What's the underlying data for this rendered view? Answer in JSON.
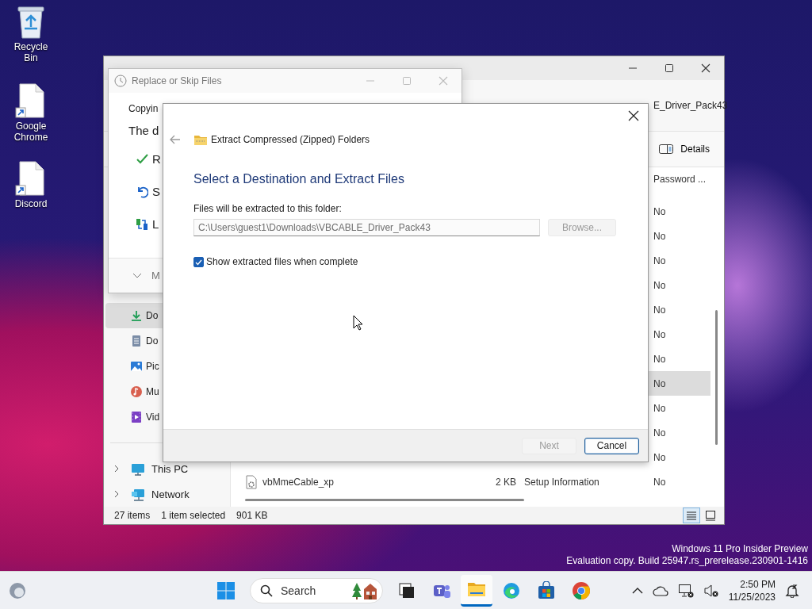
{
  "desktop_icons": [
    {
      "kind": "recycle_bin",
      "label": "Recycle Bin"
    },
    {
      "kind": "shortcut",
      "label": "Google Chrome"
    },
    {
      "kind": "shortcut",
      "label": "Discord"
    }
  ],
  "explorer": {
    "address_fragment": "E_Driver_Pack43",
    "details_button": "Details",
    "nav_items": [
      {
        "kind": "downloads",
        "label": "Do",
        "selected": true
      },
      {
        "kind": "documents",
        "label": "Do",
        "selected": false
      },
      {
        "kind": "pictures",
        "label": "Pic",
        "selected": false
      },
      {
        "kind": "music",
        "label": "Mu",
        "selected": false
      },
      {
        "kind": "videos",
        "label": "Vid",
        "selected": false
      }
    ],
    "nav_roots": [
      {
        "kind": "pc",
        "label": "This PC"
      },
      {
        "kind": "network",
        "label": "Network"
      }
    ],
    "column_header": "Password ...",
    "rows": [
      {
        "password": "No",
        "selected": false
      },
      {
        "password": "No",
        "selected": false
      },
      {
        "password": "No",
        "selected": false
      },
      {
        "password": "No",
        "selected": false
      },
      {
        "password": "No",
        "selected": false
      },
      {
        "password": "No",
        "selected": false
      },
      {
        "password": "No",
        "selected": false
      },
      {
        "password": "No",
        "selected": true
      },
      {
        "password": "No",
        "selected": false
      },
      {
        "password": "No",
        "selected": false
      },
      {
        "password": "No",
        "selected": false
      },
      {
        "name": "vbMmeCable_xp",
        "size": "2 KB",
        "type": "Setup Information",
        "password": "No",
        "selected": false
      }
    ],
    "status": {
      "items": "27 items",
      "selection": "1 item selected",
      "size": "901 KB"
    },
    "view_buttons": [
      {
        "kind": "details",
        "selected": true
      },
      {
        "kind": "tiles",
        "selected": false
      }
    ]
  },
  "replace_dialog": {
    "title": "Replace or Skip Files",
    "line_1": "Copyin",
    "line_2": "The d",
    "options": [
      {
        "kind": "replace",
        "label": "R"
      },
      {
        "kind": "skip",
        "label": "S"
      },
      {
        "kind": "compare",
        "label": "L"
      }
    ],
    "more": "M"
  },
  "extract_dialog": {
    "title": "Extract Compressed (Zipped) Folders",
    "heading": "Select a Destination and Extract Files",
    "field_label": "Files will be extracted to this folder:",
    "field": {
      "value": "C:\\Users\\guest1\\Downloads\\VBCABLE_Driver_Pack43",
      "disabled": true
    },
    "browse": {
      "label": "Browse...",
      "disabled": true
    },
    "checkbox": {
      "label": "Show extracted files when complete",
      "checked": true
    },
    "buttons": [
      {
        "label": "Next",
        "disabled": true,
        "focused": false
      },
      {
        "label": "Cancel",
        "disabled": false,
        "focused": true
      }
    ]
  },
  "os_notice": [
    "Windows 11 Pro Insider Preview",
    "Evaluation copy. Build 25947.rs_prerelease.230901-1416"
  ],
  "taskbar": {
    "search_label": "Search",
    "apps": [
      {
        "kind": "task_view",
        "selected": false
      },
      {
        "kind": "chat",
        "selected": false
      },
      {
        "kind": "file_explorer",
        "selected": true
      },
      {
        "kind": "edge",
        "selected": false
      },
      {
        "kind": "store",
        "selected": false
      },
      {
        "kind": "chrome",
        "selected": false
      }
    ],
    "time": "2:50 PM",
    "date": "11/25/2023"
  }
}
